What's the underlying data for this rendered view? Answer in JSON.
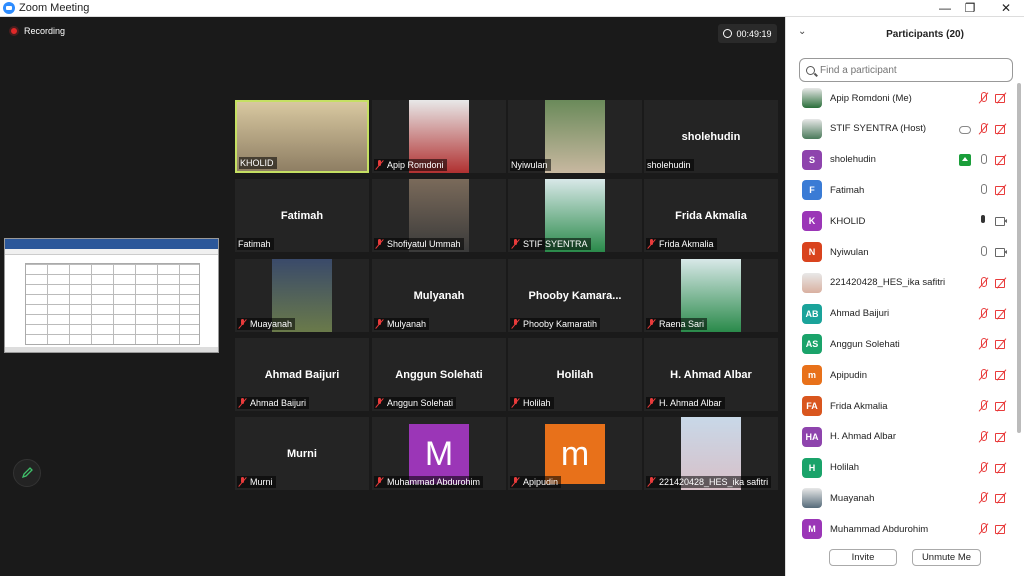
{
  "window": {
    "title": "Zoom Meeting",
    "minimize": "—",
    "restore": "❐",
    "close": "✕"
  },
  "recording": {
    "label": "Recording"
  },
  "timer": {
    "value": "00:49:19"
  },
  "gallery": [
    {
      "name": "KHOLID",
      "muted": false,
      "type": "video",
      "active": true
    },
    {
      "name": "Apip Romdoni",
      "muted": true,
      "type": "video"
    },
    {
      "name": "Nyiwulan",
      "muted": false,
      "type": "video"
    },
    {
      "name": "sholehudin",
      "muted": false,
      "type": "name",
      "display": "sholehudin"
    },
    {
      "name": "Fatimah",
      "muted": false,
      "type": "name",
      "display": "Fatimah"
    },
    {
      "name": "Shofiyatul Ummah",
      "muted": true,
      "type": "video"
    },
    {
      "name": "STIF SYENTRA",
      "muted": true,
      "type": "video"
    },
    {
      "name": "Frida Akmalia",
      "muted": true,
      "type": "name",
      "display": "Frida Akmalia"
    },
    {
      "name": "Muayanah",
      "muted": true,
      "type": "video"
    },
    {
      "name": "Mulyanah",
      "muted": true,
      "type": "name",
      "display": "Mulyanah"
    },
    {
      "name": "Phooby Kamaratih",
      "muted": true,
      "type": "name",
      "display": "Phooby  Kamara..."
    },
    {
      "name": "Raena Sari",
      "muted": true,
      "type": "video"
    },
    {
      "name": "Ahmad Baijuri",
      "muted": true,
      "type": "name",
      "display": "Ahmad Baijuri"
    },
    {
      "name": "Anggun Solehati",
      "muted": true,
      "type": "name",
      "display": "Anggun Solehati"
    },
    {
      "name": "Holilah",
      "muted": true,
      "type": "name",
      "display": "Holilah"
    },
    {
      "name": "H. Ahmad Albar",
      "muted": true,
      "type": "name",
      "display": "H. Ahmad Albar"
    },
    {
      "name": "Murni",
      "muted": true,
      "type": "name",
      "display": "Murni"
    },
    {
      "name": "Muhammad Abdurohim",
      "muted": true,
      "type": "avatar",
      "letter": "M",
      "color": "#9b36b7"
    },
    {
      "name": "Apipudin",
      "muted": true,
      "type": "avatar",
      "letter": "m",
      "color": "#e8711a"
    },
    {
      "name": "221420428_HES_ika safitri",
      "muted": true,
      "type": "video"
    }
  ],
  "panel": {
    "title": "Participants (20)",
    "search_placeholder": "Find a participant",
    "invite_label": "Invite",
    "unmute_label": "Unmute Me",
    "participants": [
      {
        "name": "Apip Romdoni (Me)",
        "initials": "",
        "color": "#2a6e3a",
        "photo": true,
        "mic": "red",
        "cam": "red"
      },
      {
        "name": "STIF SYENTRA (Host)",
        "initials": "",
        "color": "#4a7a5a",
        "photo": true,
        "mic": "red",
        "cam": "red",
        "cloud": true
      },
      {
        "name": "sholehudin",
        "initials": "S",
        "color": "#8e44ad",
        "mic": "gray",
        "cam": "red",
        "share": true
      },
      {
        "name": "Fatimah",
        "initials": "F",
        "color": "#3a7bd5",
        "mic": "gray",
        "cam": "red"
      },
      {
        "name": "KHOLID",
        "initials": "K",
        "color": "#9b36b7",
        "mic": "black",
        "cam": "gray"
      },
      {
        "name": "Nyiwulan",
        "initials": "N",
        "color": "#d9431e",
        "mic": "gray",
        "cam": "gray"
      },
      {
        "name": "221420428_HES_ika safitri",
        "initials": "",
        "color": "#d9b0a0",
        "photo": true,
        "mic": "red",
        "cam": "red"
      },
      {
        "name": "Ahmad Baijuri",
        "initials": "AB",
        "color": "#1aa39a",
        "mic": "red",
        "cam": "red"
      },
      {
        "name": "Anggun Solehati",
        "initials": "AS",
        "color": "#1aa36a",
        "mic": "red",
        "cam": "red"
      },
      {
        "name": "Apipudin",
        "initials": "m",
        "color": "#e8711a",
        "mic": "red",
        "cam": "red"
      },
      {
        "name": "Frida Akmalia",
        "initials": "FA",
        "color": "#d9561e",
        "mic": "red",
        "cam": "red"
      },
      {
        "name": "H. Ahmad Albar",
        "initials": "HA",
        "color": "#8e44ad",
        "mic": "red",
        "cam": "red"
      },
      {
        "name": "Holilah",
        "initials": "H",
        "color": "#1aa36a",
        "mic": "red",
        "cam": "red"
      },
      {
        "name": "Muayanah",
        "initials": "",
        "color": "#556b7a",
        "photo": true,
        "mic": "red",
        "cam": "red"
      },
      {
        "name": "Muhammad Abdurohim",
        "initials": "M",
        "color": "#9b36b7",
        "mic": "red",
        "cam": "red"
      }
    ]
  }
}
